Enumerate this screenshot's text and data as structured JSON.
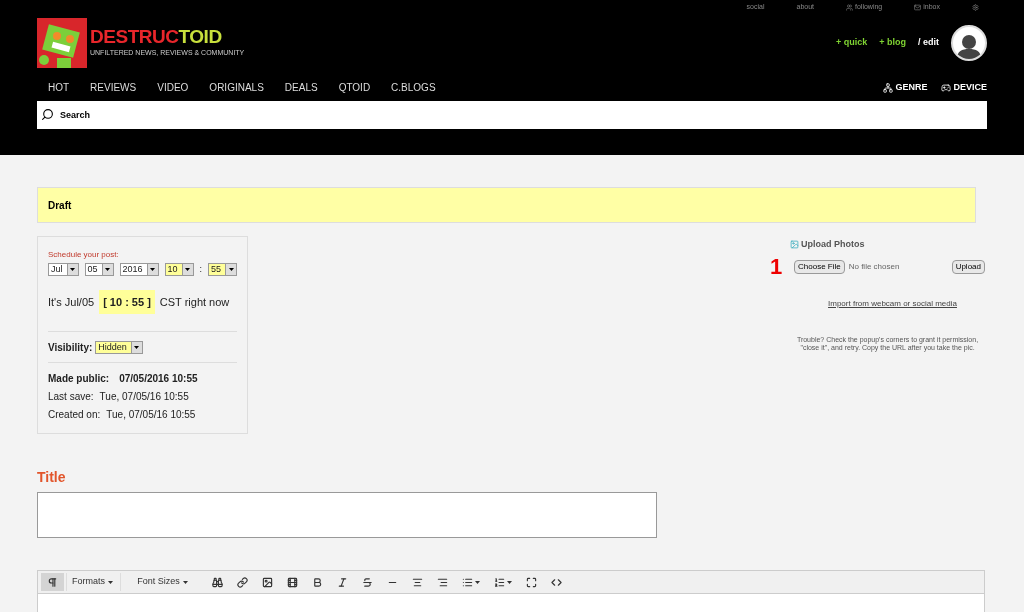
{
  "top_links": [
    {
      "label": "social",
      "kind": "plain"
    },
    {
      "label": "about",
      "kind": "plain"
    },
    {
      "label": "following",
      "kind": "people"
    },
    {
      "label": "inbox",
      "kind": "mail"
    },
    {
      "kind": "gear"
    }
  ],
  "logo": {
    "parts": [
      {
        "text": "DESTRUC",
        "color": "#e8262b"
      },
      {
        "text": "TOID",
        "color": "#c8e03c"
      }
    ],
    "tagline": "UNFILTERED NEWS, REVIEWS & COMMUNITY"
  },
  "user_links": [
    {
      "label": "+ quick",
      "kind": "green"
    },
    {
      "label": "+ blog",
      "kind": "green"
    },
    {
      "label": "/ edit",
      "kind": "white"
    }
  ],
  "nav": [
    "HOT",
    "REVIEWS",
    "VIDEO",
    "ORIGINALS",
    "DEALS",
    "QTOID",
    "C.BLOGS"
  ],
  "nav_right": [
    {
      "label": "GENRE",
      "kind": "tree"
    },
    {
      "label": "DEVICE",
      "kind": "gamepad"
    }
  ],
  "search": {
    "placeholder": "Search"
  },
  "status_banner": "Draft",
  "schedule": {
    "label": "Schedule your post:",
    "selects": [
      {
        "value": "Jul",
        "highlighted": false
      },
      {
        "value": "05",
        "highlighted": false
      },
      {
        "value": "2016",
        "highlighted": false
      },
      {
        "value": "10",
        "highlighted": true
      },
      {
        "value": "55",
        "highlighted": true
      }
    ],
    "separator": ":",
    "now_prefix": "It's Jul/05",
    "now_time": "[ 10 : 55 ]",
    "now_suffix": "CST right now",
    "visibility_label": "Visibility:",
    "visibility": {
      "value": "Hidden",
      "highlighted": true
    },
    "made_public_label": "Made public:",
    "made_public": "07/05/2016 10:55",
    "last_save_label": "Last save:",
    "last_save": "Tue, 07/05/16 10:55",
    "created_label": "Created on:",
    "created": "Tue, 07/05/16 10:55"
  },
  "upload": {
    "title": "Upload Photos",
    "step": "1",
    "choose_button": "Choose File",
    "file_status": "No file chosen",
    "upload_button": "Upload",
    "import_link": "Import from webcam or social media",
    "help": "Trouble? Check the popup's corners to grant it permission, \"close it\", and retry. Copy the URL after you take the pic."
  },
  "title_field": {
    "label": "Title"
  },
  "toolbar": [
    {
      "kind": "pilcrow",
      "selected": true
    },
    {
      "kind": "menu",
      "label": "Formats",
      "selected": false
    },
    {
      "kind": "menu-wide",
      "label": "Font Sizes",
      "selected": false
    },
    {
      "kind": "binoculars",
      "selected": false
    },
    {
      "kind": "link",
      "selected": false
    },
    {
      "kind": "image",
      "selected": false
    },
    {
      "kind": "media",
      "selected": false
    },
    {
      "kind": "bold",
      "selected": false
    },
    {
      "kind": "italic",
      "selected": false
    },
    {
      "kind": "strike",
      "selected": false
    },
    {
      "kind": "rule",
      "selected": false
    },
    {
      "kind": "center",
      "selected": false
    },
    {
      "kind": "right",
      "selected": false
    },
    {
      "kind": "bullets",
      "selected": false
    },
    {
      "kind": "numbers",
      "selected": false
    },
    {
      "kind": "fullscreen",
      "selected": false
    },
    {
      "kind": "code",
      "selected": false
    }
  ]
}
